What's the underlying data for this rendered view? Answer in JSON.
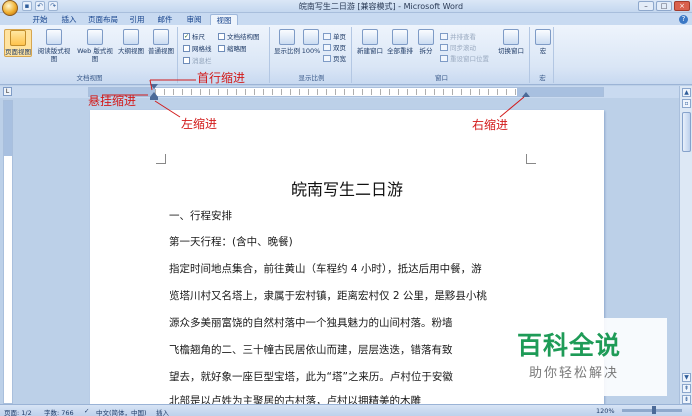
{
  "window": {
    "title": "皖南写生二日游 [兼容模式] - Microsoft Word",
    "controls": [
      "–",
      "□",
      "×"
    ]
  },
  "tabs": [
    "开始",
    "插入",
    "页面布局",
    "引用",
    "邮件",
    "审阅",
    "视图"
  ],
  "active_tab": "视图",
  "ribbon": {
    "doc_views": {
      "label": "文档视图",
      "buttons": [
        "页面视图",
        "阅读版式视图",
        "Web 版式视图",
        "大纲视图",
        "普通视图"
      ]
    },
    "show_hide": {
      "checkboxes": [
        {
          "label": "标尺",
          "checked": true
        },
        {
          "label": "网格线",
          "checked": false
        },
        {
          "label": "消息栏",
          "checked": false
        },
        {
          "label": "文档结构图",
          "checked": false
        },
        {
          "label": "缩略图",
          "checked": false
        }
      ]
    },
    "zoom": {
      "label": "显示比例",
      "buttons": [
        "显示比例",
        "100%"
      ],
      "small": [
        "单页",
        "双页",
        "页宽"
      ]
    },
    "window": {
      "label": "窗口",
      "buttons": [
        "新建窗口",
        "全部重排",
        "拆分"
      ],
      "small": [
        "并排查看",
        "同步滚动",
        "重设窗口位置"
      ],
      "switch": "切换窗口"
    },
    "macro": {
      "button": "宏",
      "label": "宏"
    }
  },
  "annotations": {
    "first_indent": "首行缩进",
    "hanging_indent": "悬挂缩进",
    "left_indent": "左缩进",
    "right_indent": "右缩进"
  },
  "document": {
    "title": "皖南写生二日游",
    "lines": [
      "一、行程安排",
      "第一天行程：(含中、晚餐)",
      "指定时间地点集合，前往黄山（车程约 4 小时），抵达后用中餐，游",
      "览塔川村又名塔上，隶属于宏村镇，距离宏村仅 2 公里，是黟县小桃",
      "源众多美丽富饶的自然村落中一个独具魅力的山间村落。粉墙",
      "飞檐翘角的二、三十幢古民居依山而建，层层迭迭，错落有致",
      "望去，就好象一座巨型宝塔，此为“塔”之来历。卢村位于安徽",
      "北部是以卢姓为主聚居的古村落，卢村以拥精美的木雕"
    ]
  },
  "watermark": {
    "title": "百科全说",
    "subtitle": "助你轻松解决"
  },
  "statusbar": {
    "page": "页面: 1/2",
    "words": "字数: 766",
    "language": "中文(简体，中国)",
    "mode": "插入",
    "zoom": "120%"
  }
}
